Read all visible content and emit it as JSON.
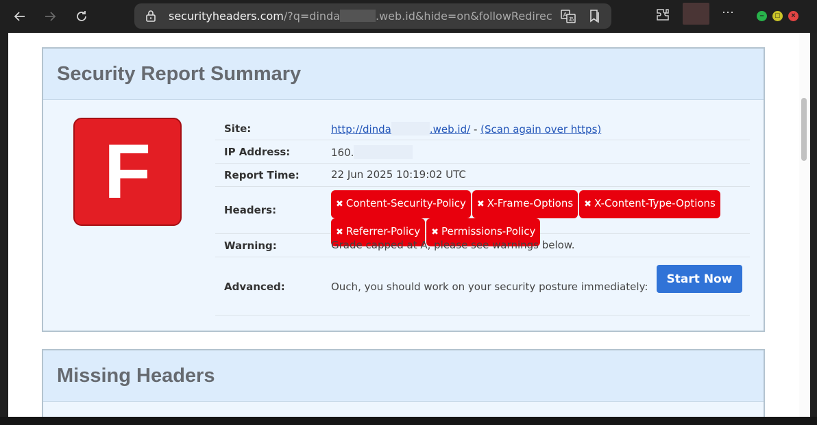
{
  "browser": {
    "url_host": "securityheaders.com",
    "url_path_start": "/?q=dinda",
    "url_path_end": ".web.id&hide=on&followRedirects="
  },
  "summary": {
    "title": "Security Report Summary",
    "grade": "F",
    "site_label": "Site:",
    "site_url": "http://dinda",
    "site_url_end": ".web.id/",
    "site_sep": " - ",
    "rescan_link": "(Scan again over https)",
    "ip_label": "IP Address:",
    "ip_value": "160.",
    "time_label": "Report Time:",
    "time_value": "22 Jun 2025 10:19:02 UTC",
    "headers_label": "Headers:",
    "missing_headers": [
      "Content-Security-Policy",
      "X-Frame-Options",
      "X-Content-Type-Options",
      "Referrer-Policy",
      "Permissions-Policy"
    ],
    "warning_label": "Warning:",
    "warning_value": "Grade capped at A, please see warnings below.",
    "advanced_label": "Advanced:",
    "advanced_value": "Ouch, you should work on your security posture immediately:",
    "start_button": "Start Now"
  },
  "missing": {
    "title": "Missing Headers"
  },
  "colors": {
    "grade_bg": "#e31e24",
    "badge_bg": "#e8000d",
    "button_bg": "#3073d7",
    "card_header_bg": "#dcecfc"
  }
}
